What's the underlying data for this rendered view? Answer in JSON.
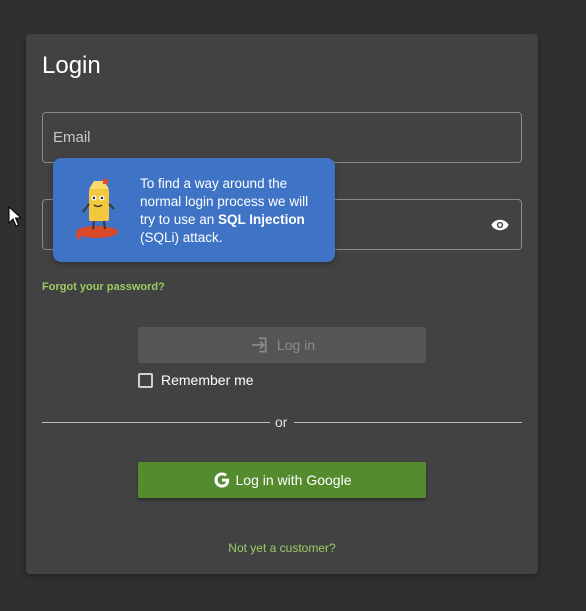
{
  "login": {
    "title": "Login",
    "email_label": "Email",
    "forgot_password": "Forgot your password?",
    "login_button": "Log in",
    "remember_me": "Remember me",
    "divider_text": "or",
    "google_button": "Log in with Google",
    "not_customer": "Not yet a customer?"
  },
  "tooltip": {
    "text_before": "To find a way around the normal login process we will try to use an ",
    "text_bold": "SQL Injection",
    "text_after": " (SQLi) attack."
  },
  "colors": {
    "background": "#303030",
    "card": "#424242",
    "accent_green": "#9ccc65",
    "google_button": "#558b2f",
    "tooltip_blue": "#3f73c6"
  },
  "icons": {
    "login": "login-icon",
    "visibility": "eye-icon",
    "google": "google-g-icon",
    "mascot": "juice-box-mascot"
  }
}
